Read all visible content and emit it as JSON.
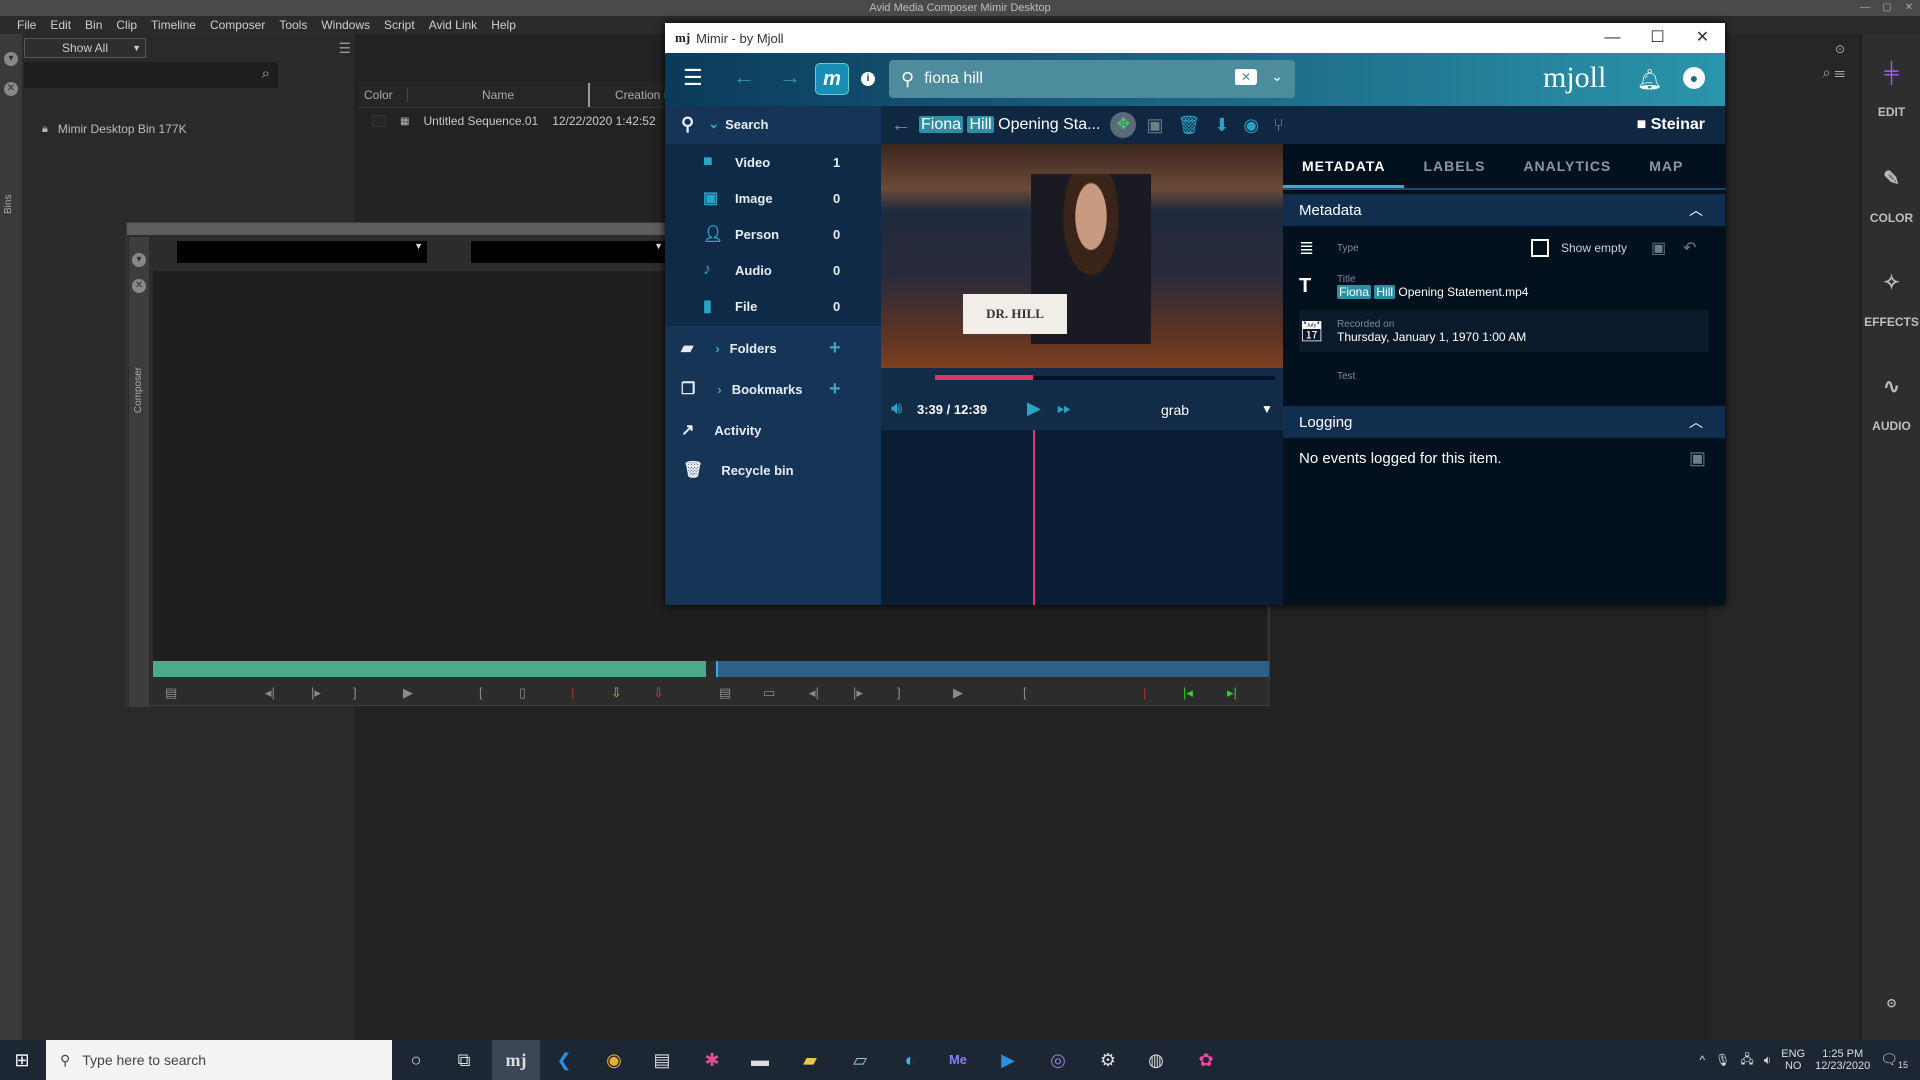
{
  "avid": {
    "window_title": "Avid Media Composer Mimir Desktop",
    "menu": [
      "File",
      "Edit",
      "Bin",
      "Clip",
      "Timeline",
      "Composer",
      "Tools",
      "Windows",
      "Script",
      "Avid Link",
      "Help"
    ],
    "bins_tab": "Bins",
    "show_all": "Show All",
    "bin_item": "Mimir Desktop Bin  177K",
    "bin_columns": [
      "Color",
      "Name",
      "Creation Date"
    ],
    "sequence": {
      "name": "Untitled Sequence.01",
      "created": "12/22/2020 1:42:52"
    },
    "composer_tab": "Composer",
    "workspaces": [
      {
        "label": "EDIT",
        "icon": "edit-workspace-icon",
        "color": "#a855f7"
      },
      {
        "label": "COLOR",
        "icon": "eyedropper-icon"
      },
      {
        "label": "EFFECTS",
        "icon": "magic-wand-icon"
      },
      {
        "label": "AUDIO",
        "icon": "waveform-icon"
      }
    ]
  },
  "mimir": {
    "window_title": "Mimir - by Mjoll",
    "search_value": "fiona hill",
    "brand": "mjoll",
    "sidebar": {
      "search_label": "Search",
      "categories": [
        {
          "label": "Video",
          "count": "1"
        },
        {
          "label": "Image",
          "count": "0"
        },
        {
          "label": "Person",
          "count": "0"
        },
        {
          "label": "Audio",
          "count": "0"
        },
        {
          "label": "File",
          "count": "0"
        }
      ],
      "folders": "Folders",
      "bookmarks": "Bookmarks",
      "activity": "Activity",
      "recycle_bin": "Recycle bin"
    },
    "item": {
      "title_hl1": "Fiona",
      "title_hl2": "Hill",
      "title_rest": "Opening Sta...",
      "folder": "Steinar",
      "nameplate": "DR. HILL",
      "time": "3:39 / 12:39",
      "progress": 0.289,
      "grab_label": "grab"
    },
    "tabs": [
      "METADATA",
      "LABELS",
      "ANALYTICS",
      "MAP"
    ],
    "active_tab": "METADATA",
    "metadata": {
      "section": "Metadata",
      "type_label": "Type",
      "show_empty": "Show empty",
      "title_label": "Title",
      "title_hl1": "Fiona",
      "title_hl2": "Hill",
      "title_rest": "Opening Statement.mp4",
      "recorded_label": "Recorded on",
      "recorded_value": "Thursday, January 1, 1970 1:00 AM",
      "test_label": "Test"
    },
    "logging": {
      "section": "Logging",
      "empty": "No events logged for this item."
    }
  },
  "taskbar": {
    "search_placeholder": "Type here to search",
    "lang1": "ENG",
    "lang2": "NO",
    "time": "1:25 PM",
    "date": "12/23/2020",
    "notifications": "15"
  }
}
